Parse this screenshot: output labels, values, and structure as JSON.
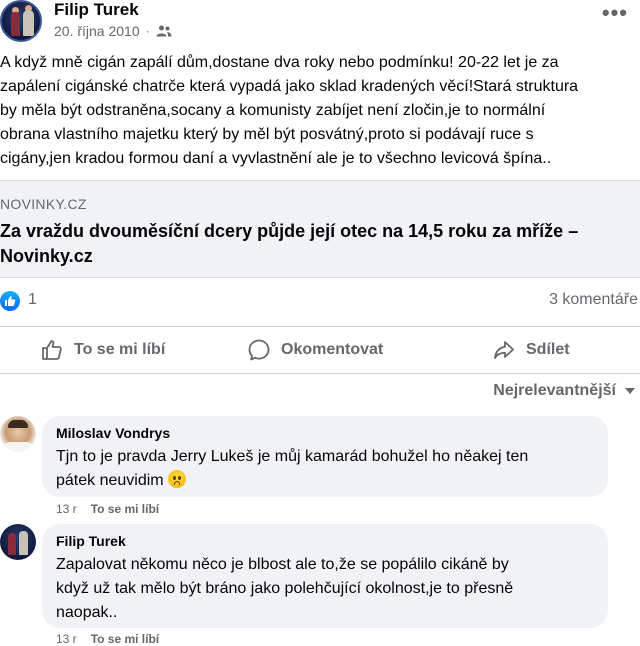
{
  "post": {
    "author": "Filip Turek",
    "date": "20. října 2010",
    "separator": "·",
    "audience_icon": "friends-icon",
    "more_icon": "more-dots-icon",
    "more_label": "•••",
    "text": "A když mně cigán zapálí dům,dostane dva roky nebo podmínku! 20-22 let je za\nzapálení cigánské chatrče která vypadá jako sklad kradených věcí!Stará struktura\nby měla být odstraněna,socany a komunisty zabíjet není zločin,je to normální\nobrana vlastního majetku který by měl být posvátný,proto si podávají ruce s\ncigány,jen kradou formou daní a vyvlastnění ale je to všechno levicová špína.."
  },
  "link_preview": {
    "domain": "NOVINKY.CZ",
    "title": "Za vraždu dvouměsíční dcery půjde její otec na 14,5 roku za mříže –\nNovinky.cz"
  },
  "reactions": {
    "icon": "like-icon",
    "count": "1",
    "comments_label": "3 komentáře"
  },
  "actions": {
    "like": "To se mi líbí",
    "comment": "Okomentovat",
    "share": "Sdílet"
  },
  "sort": {
    "label": "Nejrelevantnější",
    "icon": "caret-down-icon"
  },
  "comments": [
    {
      "author": "Miloslav Vondrys",
      "text": "Tjn to je pravda Jerry Lukeš je můj kamarád bohužel ho něakej ten\npátek neuvidim",
      "emoji": "sad-face-emoji",
      "time": "13 r",
      "like_label": "To se mi líbí"
    },
    {
      "author": "Filip Turek",
      "text": "Zapalovat někomu něco je blbost ale to,že se popálilo cikáně by\nkdyž už tak mělo být bráno jako polehčující okolnost,je to přesně\nnaopak..",
      "time": "13 r",
      "like_label": "To se mi líbí"
    }
  ],
  "colors": {
    "text_primary": "#050505",
    "text_secondary": "#65676b",
    "bubble_bg": "#f0f2f5",
    "like_blue": "#0866ff",
    "divider": "#ced0d4"
  }
}
